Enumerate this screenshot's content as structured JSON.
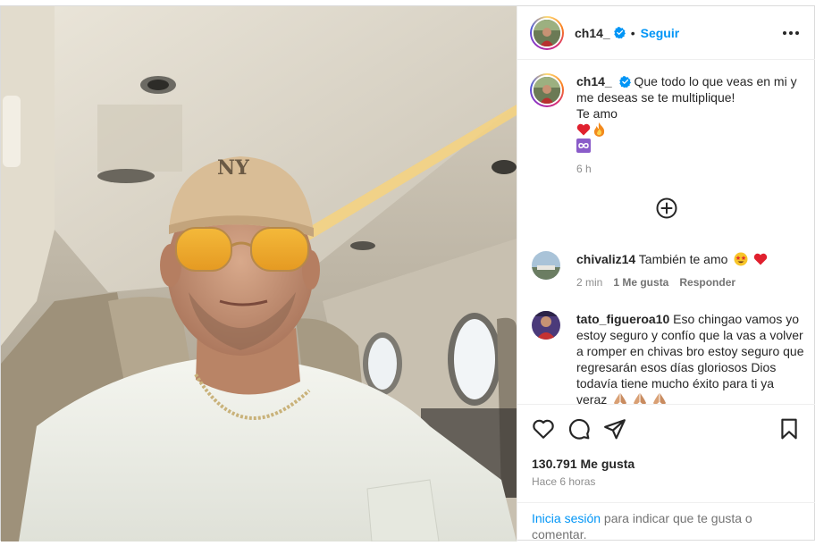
{
  "post": {
    "author": {
      "username": "ch14_",
      "verified": true,
      "follow_label": "Seguir",
      "separator": "•",
      "more_icon": "more-horizontal-icon"
    },
    "caption": {
      "username": "ch14_",
      "text_line1": "Que todo lo que veas en mi y me deseas se te multiplique!",
      "text_line2": "Te amo",
      "emojis": [
        "red-heart",
        "fire",
        "infinity"
      ],
      "time": "6 h"
    },
    "load_more_icon": "plus-circle-icon",
    "comments": [
      {
        "username": "chivaliz14",
        "text": "También te amo",
        "emojis": [
          "star-struck",
          "red-heart"
        ],
        "time": "2 min",
        "likes": "1 Me gusta",
        "reply": "Responder"
      },
      {
        "username": "tato_figueroa10",
        "text": "Eso chingao vamos yo estoy seguro y confío que la vas a volver a romper en chivas bro estoy seguro que regresarán esos días gloriosos Dios todavía tiene mucho éxito para ti ya veraz",
        "emojis": [
          "folded-hands",
          "folded-hands",
          "folded-hands"
        ]
      }
    ],
    "actions": {
      "like_icon": "heart-icon",
      "comment_icon": "comment-icon",
      "share_icon": "share-icon",
      "save_icon": "bookmark-icon"
    },
    "likes_count": "130.791 Me gusta",
    "posted_ago": "Hace 6 horas",
    "login_prompt": {
      "link": "Inicia sesión",
      "text": " para indicar que te gusta o comentar."
    }
  },
  "colors": {
    "link_blue": "#0095f6",
    "text": "#262626",
    "muted": "#8e8e8e",
    "border": "#dbdbdb"
  }
}
